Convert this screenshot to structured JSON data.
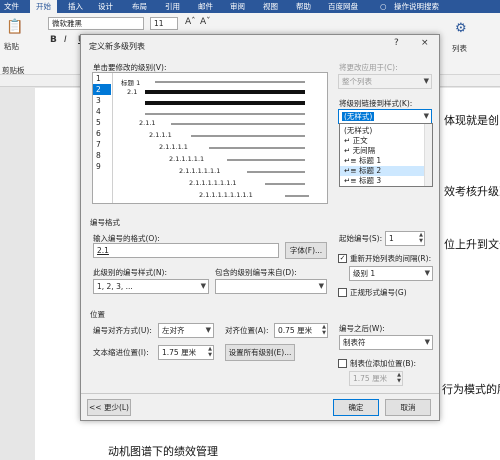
{
  "ribbon": {
    "tabs": [
      "文件",
      "开始",
      "插入",
      "设计",
      "布局",
      "引用",
      "邮件",
      "审阅",
      "视图",
      "帮助",
      "百度网盘"
    ],
    "search_hint": "操作说明搜索",
    "font_name": "微软雅黑",
    "font_size": "11",
    "paste_label": "粘贴",
    "clipboard_label": "剪贴板",
    "col_label": "列表"
  },
  "document": {
    "lines": [
      "体现就是创",
      "效考核升级到",
      "位上升到文化",
      "行为模式的层",
      "动机图谱下的绩效管理"
    ]
  },
  "dialog": {
    "title": "定义新多级列表",
    "help": "?",
    "close": "×",
    "click_level_label": "单击要修改的级别(V):",
    "levels": [
      "1",
      "2",
      "3",
      "4",
      "5",
      "6",
      "7",
      "8",
      "9"
    ],
    "selected_level": "2",
    "preview_labels": [
      "标题 1",
      "2.1",
      "2.1.1",
      "2.1.1.1",
      "2.1.1.1.1",
      "2.1.1.1.1.1",
      "2.1.1.1.1.1.1",
      "2.1.1.1.1.1.1.1",
      "2.1.1.1.1.1.1.1.1"
    ],
    "apply_to_label": "将更改应用于(C):",
    "apply_to_value": "整个列表",
    "link_style_label": "将级别链接到样式(K):",
    "link_style_value": "(无样式)",
    "style_options": [
      "(无样式)",
      "正文",
      "无间隔",
      "标题 1",
      "标题 2",
      "标题 3"
    ],
    "style_selected": "标题 2",
    "number_format_section": "编号格式",
    "enter_format_label": "输入编号的格式(O):",
    "format_value": "2.1",
    "font_button": "字体(F)...",
    "number_style_label": "此级别的编号样式(N):",
    "number_style_value": "1, 2, 3, ...",
    "include_level_label": "包含的级别编号来自(D):",
    "include_level_value": "",
    "start_at_label": "起始编号(S):",
    "start_at_value": "1",
    "restart_label": "重新开始列表的间隔(R):",
    "restart_value": "级别 1",
    "legal_label": "正规形式编号(G)",
    "position_section": "位置",
    "alignment_label": "编号对齐方式(U):",
    "alignment_value": "左对齐",
    "align_at_label": "对齐位置(A):",
    "align_at_value": "0.75 厘米",
    "follow_label": "编号之后(W):",
    "follow_value": "制表符",
    "indent_label": "文本缩进位置(I):",
    "indent_value": "1.75 厘米",
    "set_all_button": "设置所有级别(E)...",
    "tab_stop_label": "制表位添加位置(B):",
    "tab_stop_value": "1.75 厘米",
    "less_button": "<< 更少(L)",
    "ok_button": "确定",
    "cancel_button": "取消"
  },
  "colors": {
    "accent": "#2b579a",
    "selection": "#0078d7",
    "highlight": "#cde8ff"
  }
}
